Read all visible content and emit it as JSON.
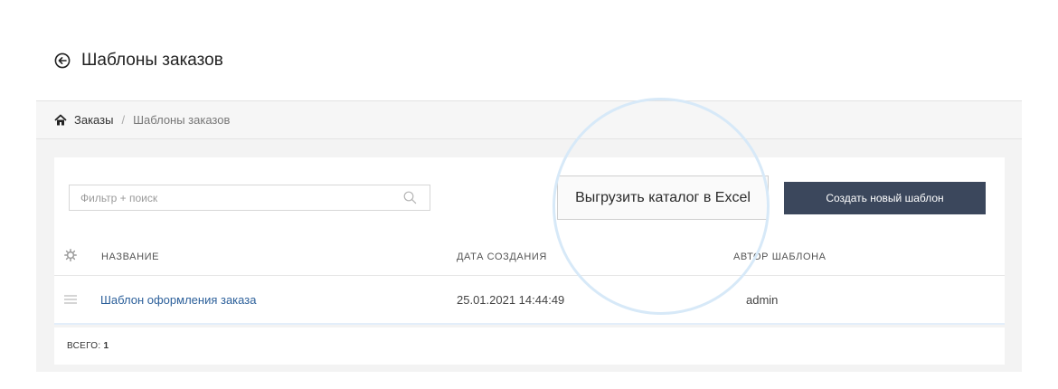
{
  "page": {
    "title": "Шаблоны заказов"
  },
  "breadcrumb": {
    "items": [
      "Заказы",
      "Шаблоны заказов"
    ],
    "separator": "/"
  },
  "toolbar": {
    "search_placeholder": "Фильтр + поиск",
    "export_label": "Выгрузить каталог в Excel",
    "create_label": "Создать новый шаблон"
  },
  "table": {
    "columns": [
      "НАЗВАНИЕ",
      "ДАТА СОЗДАНИЯ",
      "АВТОР ШАБЛОНА"
    ],
    "rows": [
      {
        "name": "Шаблон оформления заказа",
        "created": "25.01.2021 14:44:49",
        "author": "admin"
      }
    ]
  },
  "footer": {
    "total_label": "ВСЕГО:",
    "total_value": "1"
  },
  "colors": {
    "primary_button": "#3b475c",
    "link": "#2b5f9a",
    "magnifier_ring": "#d7e9f8"
  },
  "icons": [
    "back-arrow-icon",
    "home-icon",
    "search-icon",
    "gear-icon",
    "drag-handle-icon"
  ]
}
